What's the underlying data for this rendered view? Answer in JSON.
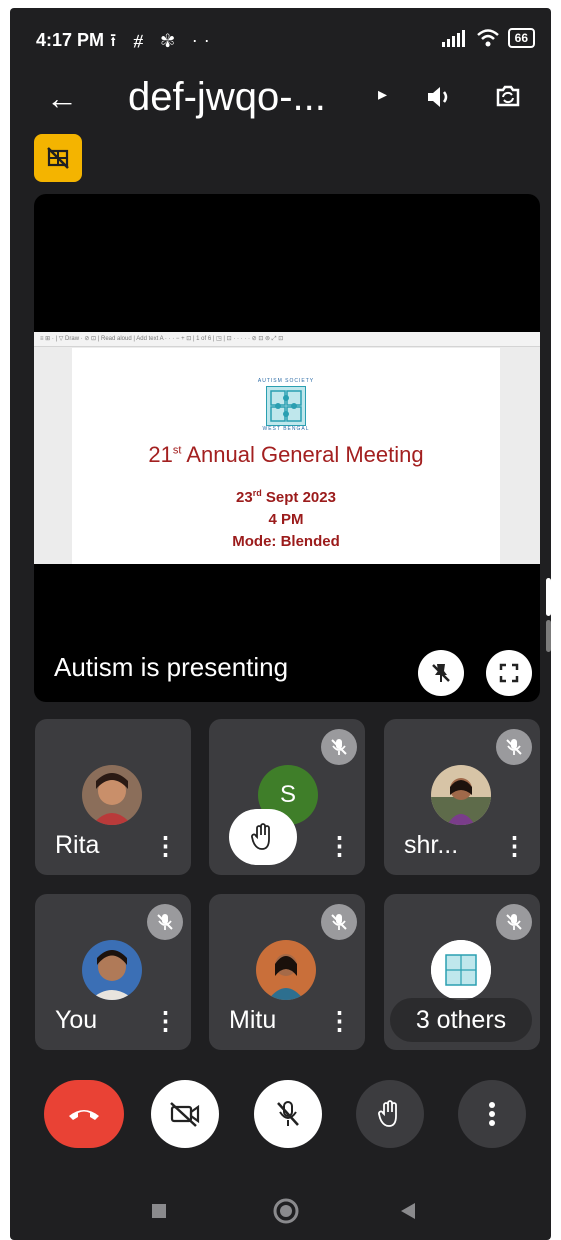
{
  "status_bar": {
    "time": "4:17 PM",
    "notif_icons": "⭱ ⧣ ✾ ··",
    "battery": "66"
  },
  "top_bar": {
    "meeting_code": "def-jwqo-..."
  },
  "slide": {
    "toolbar_text": "≡  ⊞ · |  ▽ Draw  ·  ⊘  ⊡  |  Read aloud  |  Add text A  ·  ·  ·  − + ⊡  |  1  of 6  |  ◳  |  ⊡  ·  ·  ·  ·  ·  ⊘  ⊡  ⊚  ⤢  ⊡",
    "logo_top": "AUTISM SOCIETY",
    "logo_bottom": "WEST BENGAL",
    "title_num": "21",
    "title_sup": "st",
    "title_rest": " Annual General Meeting",
    "date_num": "23",
    "date_sup": "rd",
    "date_rest": " Sept 2023",
    "time": "4 PM",
    "mode": "Mode: Blended"
  },
  "presenting_label": "Autism  is presenting",
  "participants": [
    {
      "name": "Rita",
      "menu": "⋮"
    },
    {
      "initial": "S",
      "menu": "⋮"
    },
    {
      "name": "shr...",
      "menu": "⋮"
    },
    {
      "name": "You",
      "menu": "⋮"
    },
    {
      "name": "Mitu",
      "menu": "⋮"
    },
    {
      "others": "3 others"
    }
  ],
  "colors": {
    "end_call": "#e94235",
    "raise_hand_badge": "#f4b400",
    "background": "#1f1f21",
    "tile": "#3c3c3f"
  }
}
